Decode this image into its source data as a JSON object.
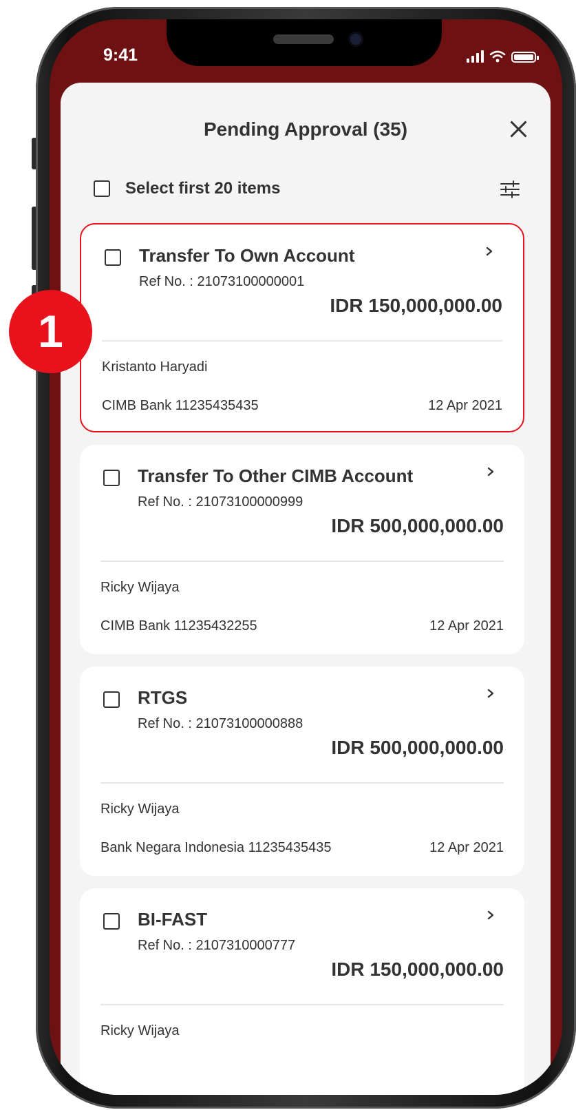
{
  "status_bar": {
    "time": "9:41"
  },
  "sheet": {
    "title": "Pending Approval (35)",
    "select_label": "Select first 20 items"
  },
  "cards": [
    {
      "title": "Transfer To Own Account",
      "ref": "Ref No. : 21073100000001",
      "amount": "IDR 150,000,000.00",
      "name": "Kristanto Haryadi",
      "bank": "CIMB Bank 11235435435",
      "date": "12 Apr 2021"
    },
    {
      "title": "Transfer To Other CIMB Account",
      "ref": "Ref No. : 21073100000999",
      "amount": "IDR 500,000,000.00",
      "name": "Ricky Wijaya",
      "bank": "CIMB Bank 11235432255",
      "date": "12 Apr 2021"
    },
    {
      "title": "RTGS",
      "ref": "Ref No. : 21073100000888",
      "amount": "IDR 500,000,000.00",
      "name": "Ricky Wijaya",
      "bank": "Bank Negara Indonesia 11235435435",
      "date": "12 Apr 2021"
    },
    {
      "title": "BI-FAST",
      "ref": "Ref No. : 2107310000777",
      "amount": "IDR 150,000,000.00",
      "name": "Ricky Wijaya"
    }
  ],
  "marker": {
    "label": "1"
  },
  "colors": {
    "brand": "#6e1112",
    "highlight": "#e8121d",
    "sheet_bg": "#f4f4f4"
  },
  "icons": [
    "close-icon",
    "checkbox-icon",
    "filter-sliders-icon",
    "chevron-right-icon",
    "signal-icon",
    "wifi-icon",
    "battery-icon"
  ]
}
